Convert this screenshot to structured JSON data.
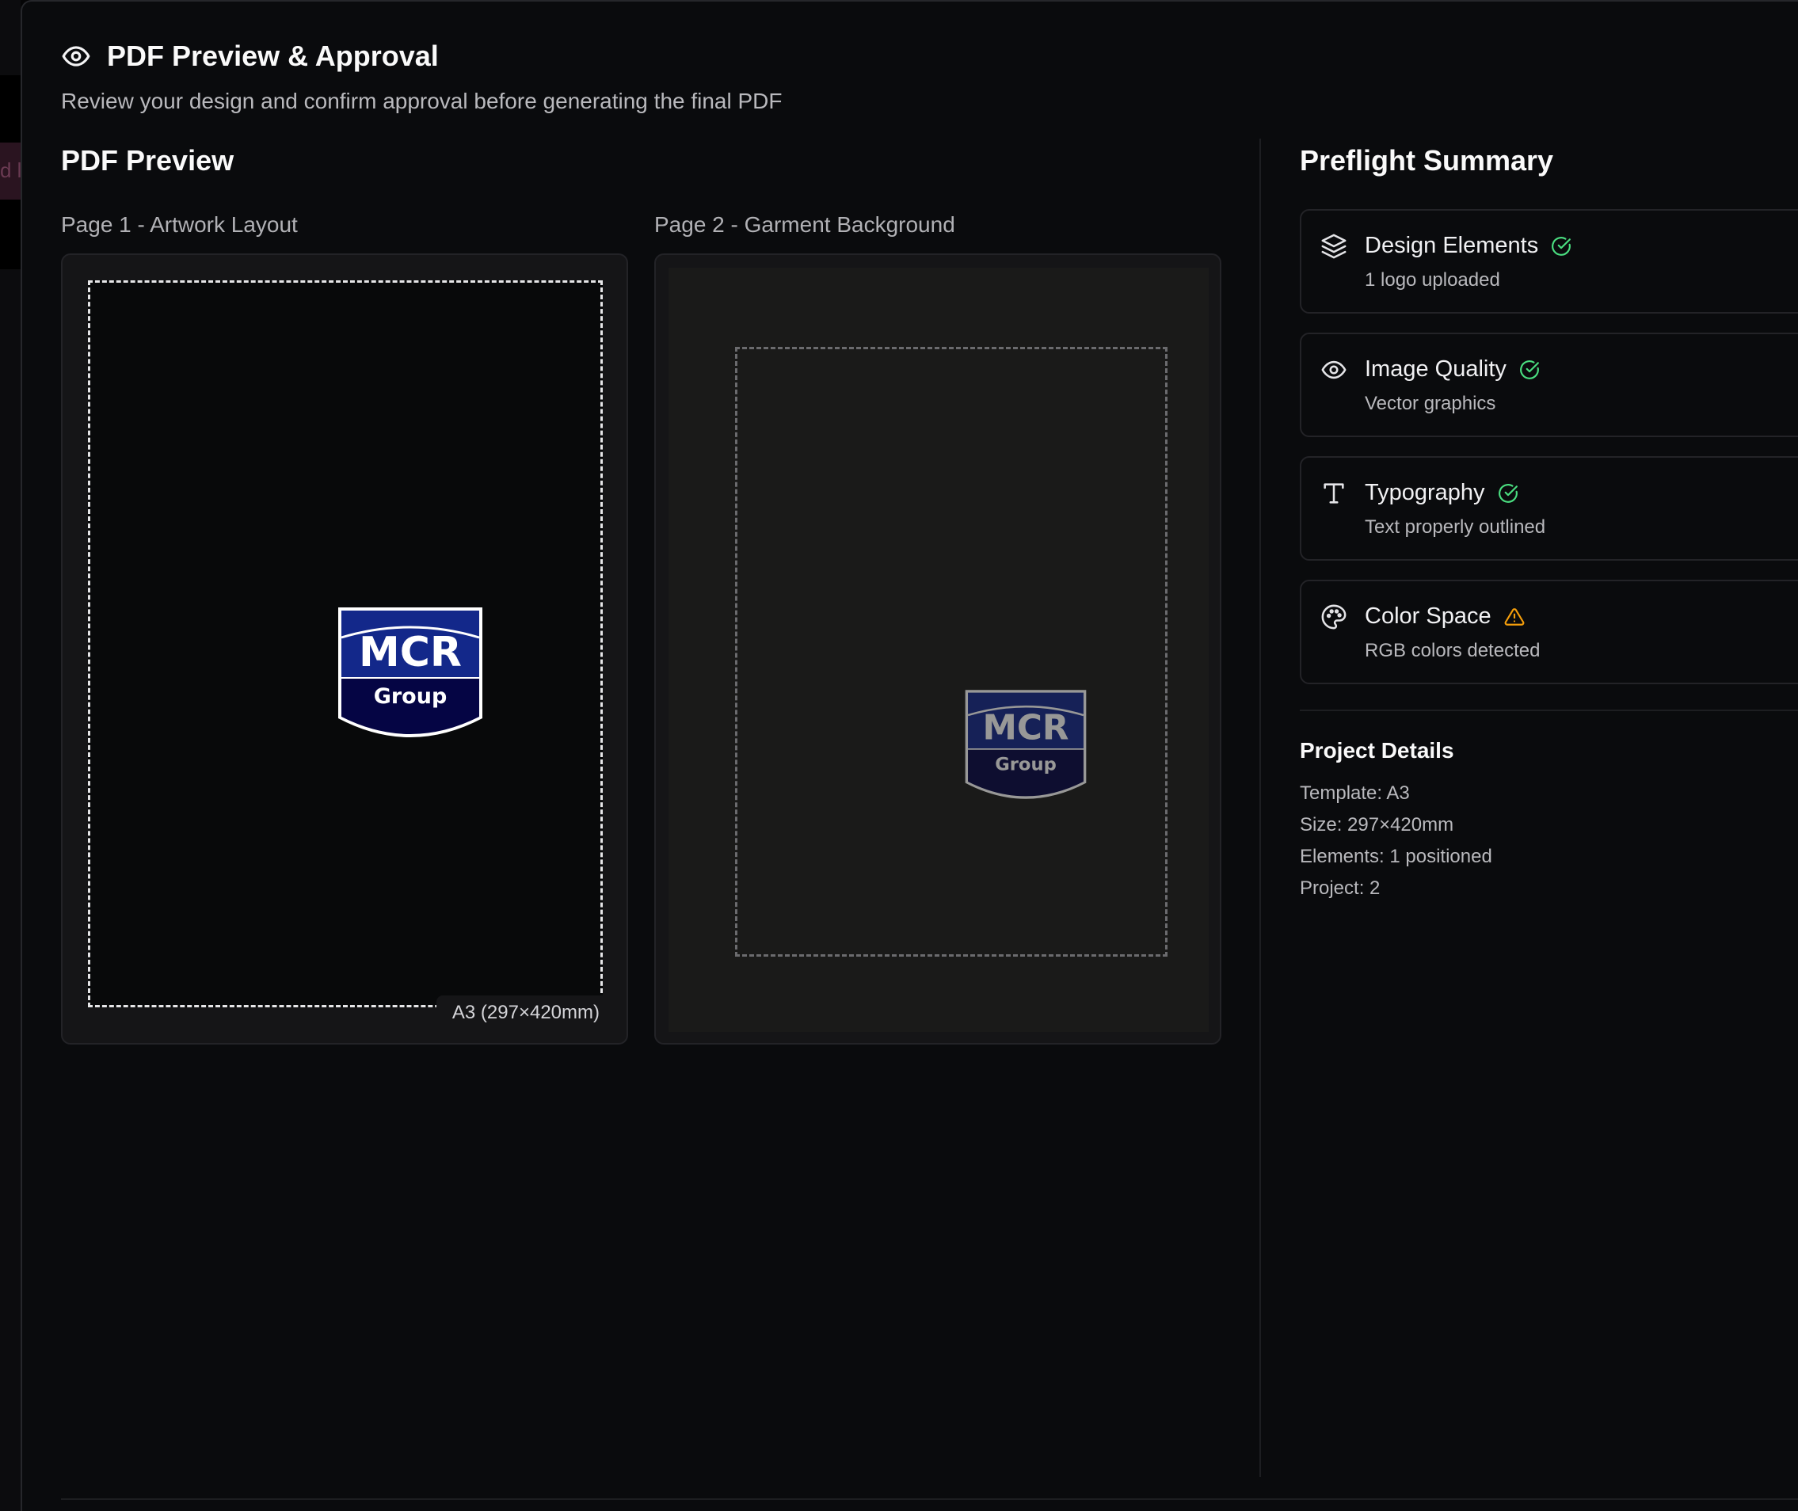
{
  "header": {
    "title": "PDF Preview & Approval",
    "subtitle": "Review your design and confirm approval before generating the final PDF",
    "icon": "eye-icon"
  },
  "preview": {
    "title": "PDF Preview",
    "pages": [
      {
        "label": "Page 1 - Artwork Layout",
        "size_badge": "A3 (297×420mm)"
      },
      {
        "label": "Page 2 - Garment Background"
      }
    ],
    "logo": {
      "line1": "MCR",
      "line2": "Group"
    }
  },
  "preflight": {
    "title": "Preflight Summary",
    "checks": [
      {
        "title": "Design Elements",
        "sub": "1 logo uploaded",
        "icon": "layers-icon",
        "status": "ok"
      },
      {
        "title": "Image Quality",
        "sub": "Vector graphics",
        "icon": "eye-icon",
        "status": "ok"
      },
      {
        "title": "Typography",
        "sub": "Text properly outlined",
        "icon": "type-icon",
        "status": "ok"
      },
      {
        "title": "Color Space",
        "sub": "RGB colors detected",
        "icon": "palette-icon",
        "status": "warning"
      }
    ]
  },
  "project_details": {
    "title": "Project Details",
    "lines": [
      "Template: A3",
      "Size: 297×420mm",
      "Elements: 1 positioned",
      "Project: 2"
    ]
  },
  "colors": {
    "ok": "#4ade80",
    "warning": "#f59e0b",
    "logo_blue": "#13288a",
    "logo_navy": "#050544"
  },
  "backdrop": {
    "partial_text": "d l"
  }
}
